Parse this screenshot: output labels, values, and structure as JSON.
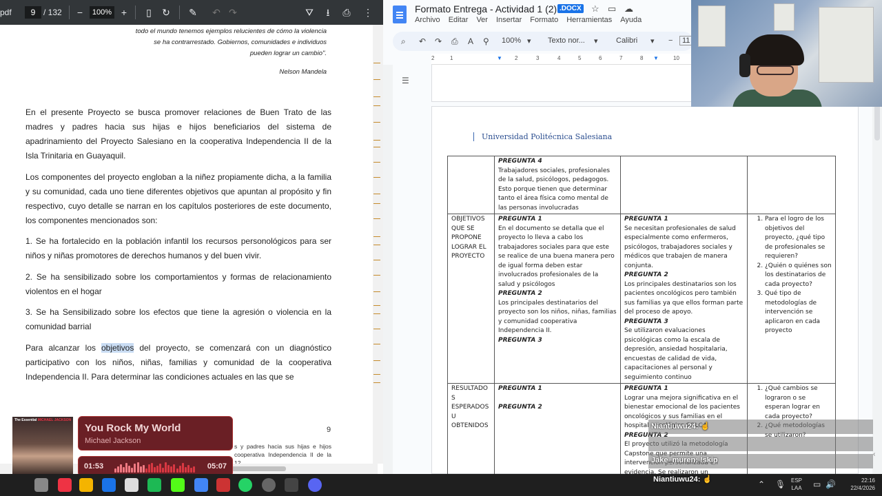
{
  "pdf": {
    "file_fragment": "pdf",
    "page_current": "9",
    "page_total": "/ 132",
    "zoom": "100%",
    "quote_lines": [
      "todo el mundo tenemos ejemplos relucientes de cómo la violencia",
      "se ha contrarrestado. Gobiernos, comunidades e individuos",
      "pueden lograr un cambio\".",
      "Nelson Mandela"
    ],
    "paragraphs": [
      "En el presente Proyecto se busca promover relaciones de Buen Trato de las madres y padres hacia sus hijas e hijos beneficiarios del sistema de apadrinamiento del Proyecto Salesiano en la cooperativa Independencia II de la Isla Trinitaria en Guayaquil.",
      "Los componentes del proyecto engloban a la niñez propiamente dicha, a la  familia y su comunidad, cada uno tiene diferentes objetivos que apuntan al propósito y fin respectivo, cuyo detalle se narran en los capítulos posteriores de este documento, los componentes  mencionados son:",
      "1. Se ha fortalecido en la población infantil los recursos personológicos para ser niños y niñas promotores de derechos humanos y del buen vivir.",
      "2. Se ha sensibilizado sobre los comportamientos y formas de relacionamiento violentos en el hogar",
      "3. Se ha Sensibilizado sobre los efectos que tiene la agresión o violencia en la comunidad barrial"
    ],
    "last_para_before": "Para alcanzar los ",
    "last_para_highlight": "objetivos",
    "last_para_after": " del proyecto, se comenzará con un diagnóstico participativo con los niños, niñas, familias y comunidad de la cooperativa Independencia II. Para determinar las condiciones actuales en las que se",
    "page_number": "9",
    "footnote": "s y padres hacia sus hijas e hijos cooperativa Independencia II de la 12."
  },
  "docs": {
    "title": "Formato Entrega - Actividad 1 (2)",
    "badge": ".DOCX",
    "menu": [
      "Archivo",
      "Editar",
      "Ver",
      "Insertar",
      "Formato",
      "Herramientas",
      "Ayuda"
    ],
    "zoom": "100%",
    "style_select": "Texto nor...",
    "font_select": "Calibri",
    "font_size": "11",
    "ruler_numbers": [
      "2",
      "1",
      "1",
      "2",
      "3",
      "4",
      "5",
      "6",
      "7",
      "8",
      "9",
      "10"
    ],
    "header": "Universidad Politécnica Salesiana",
    "table": {
      "row0": {
        "c1_head": "PREGUNTA 4",
        "c1_text": "Trabajadores sociales, profesionales de la salud, psicólogos,  pedagogos. Esto porque tienen que determinar tanto el área física como mental de las personas involucradas"
      },
      "row1": {
        "label": "OBJETIVOS QUE SE PROPONE LOGRAR EL PROYECTO",
        "c1_q1": "PREGUNTA 1",
        "c1_t1": "En el documento se detalla que el proyecto lo lleva a cabo los trabajadores sociales para que este se realice de una buena manera pero de igual forma deben estar involucrados profesionales de la salud y psicólogos",
        "c1_q2": "PREGUNTA 2",
        "c1_t2": "Los principales destinatarios del proyecto son los niños, niñas, familias y comunidad cooperativa Independencia II.",
        "c1_q3": "PREGUNTA 3",
        "c2_q1": "PREGUNTA 1",
        "c2_t1": "Se necesitan profesionales de salud especialmente como enfermeros, psicólogos, trabajadores sociales y médicos que trabajen de manera conjunta.",
        "c2_q2": "PREGUNTA 2",
        "c2_t2": "Los principales destinatarios son los pacientes oncológicos pero también sus familias ya que ellos forman parte del proceso de apoyo.",
        "c2_q3": "PREGUNTA 3",
        "c2_t3": "Se utilizaron evaluaciones psicológicas como la escala de depresión, ansiedad hospitalaria, encuestas de calidad de vida,  capacitaciones al personal y seguimiento continuo",
        "questions": [
          "Para el logro de los objetivos del proyecto, ¿qué tipo de profesionales se requieren?",
          "¿Quién o quiénes son los destinatarios de cada proyecto?",
          "Qué tipo de metodologías de intervención se aplicaron en cada proyecto"
        ]
      },
      "row2": {
        "label": "RESULTADO S ESPERADOS U OBTENIDOS",
        "c1_q1": "PREGUNTA 1",
        "c1_q2": "PREGUNTA 2",
        "c2_q1": "PREGUNTA 1",
        "c2_t1": "Lograr una mejora significativa en el bienestar emocional de los pacientes oncológicos y sus familias en el hospital oncológico SOLCA",
        "c2_q2": "PREGUNTA 2",
        "c2_t2": "El proyecto utilizó la metodología Capstone que permite una intervención personalizada en evidencia. Se realizaron un",
        "questions": [
          "¿Qué cambios se lograron o se esperan lograr en cada proyecto?",
          "¿Qué metodologías se utilizaron?"
        ]
      }
    }
  },
  "music": {
    "cover_label_a": "The Essential",
    "cover_label_b": "MICHAEL JACKSON",
    "title": "You Rock My World",
    "artist": "Michael Jackson",
    "elapsed": "01:53",
    "duration": "05:07",
    "progress": 0.37
  },
  "chat": [
    {
      "name": "Niantiuwu24:",
      "msg": "☝"
    },
    {
      "name": "",
      "msg": ""
    },
    {
      "name": "Jake_muren:",
      "msg": "!skip"
    },
    {
      "name": "Niantiuwu24:",
      "msg": "☝"
    }
  ],
  "taskbar": {
    "lang_1": "ESP",
    "lang_2": "LAA",
    "time": "22:16",
    "date": "22/4/2026",
    "colors": {
      "accent": "#1a73e8",
      "music_bg": "#6a1f25"
    }
  }
}
